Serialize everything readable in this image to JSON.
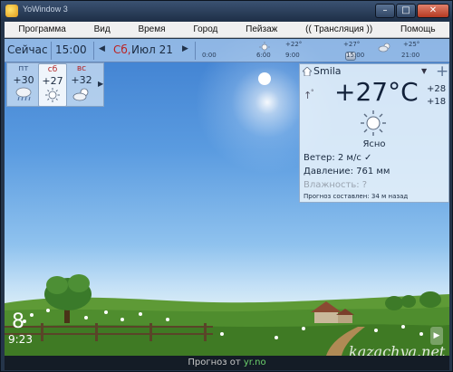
{
  "window": {
    "title": "YoWindow 3",
    "buttons": {
      "minimize": "–",
      "maximize": "□",
      "close": "✕"
    }
  },
  "menu": [
    "Программа",
    "Вид",
    "Время",
    "Город",
    "Пейзаж",
    "(( Трансляция ))",
    "Помощь"
  ],
  "timebar": {
    "now_label": "Сейчас",
    "clock": "15:00",
    "date_day": "Сб,",
    "date_rest": "Июл 21",
    "times": [
      "0:00",
      "6:00",
      "9:00",
      "15:00",
      "21:00"
    ],
    "temps": [
      "+22°",
      "+27°",
      "+25°"
    ]
  },
  "forecast": [
    {
      "day": "пт",
      "temp": "+30",
      "icon": "rain-cloud-icon",
      "color": "#33507a"
    },
    {
      "day": "сб",
      "temp": "+27",
      "icon": "sun-icon",
      "color": "#b22222"
    },
    {
      "day": "вс",
      "temp": "+32",
      "icon": "partly-cloudy-icon",
      "color": "#b22222"
    }
  ],
  "current": {
    "city": "Smila",
    "temperature": "+27°C",
    "high": "+28",
    "low": "+18",
    "degree_marker": "°",
    "condition": "Ясно",
    "wind": "Ветер:  2 м/с",
    "pressure": "Давление:  761 мм",
    "humidity": "Влажность:  ?",
    "source_line": "Прогноз составлен:  34 м назад"
  },
  "scene": {
    "big_digit": "8",
    "corner_text": "9:23",
    "watermark": "kazachya.net"
  },
  "status": {
    "prefix": "Прогноз от ",
    "link": "yr.no"
  },
  "colors": {
    "sky_top": "#3e7fd0",
    "grass": "#4f8d2e",
    "link": "#6bd06b"
  }
}
